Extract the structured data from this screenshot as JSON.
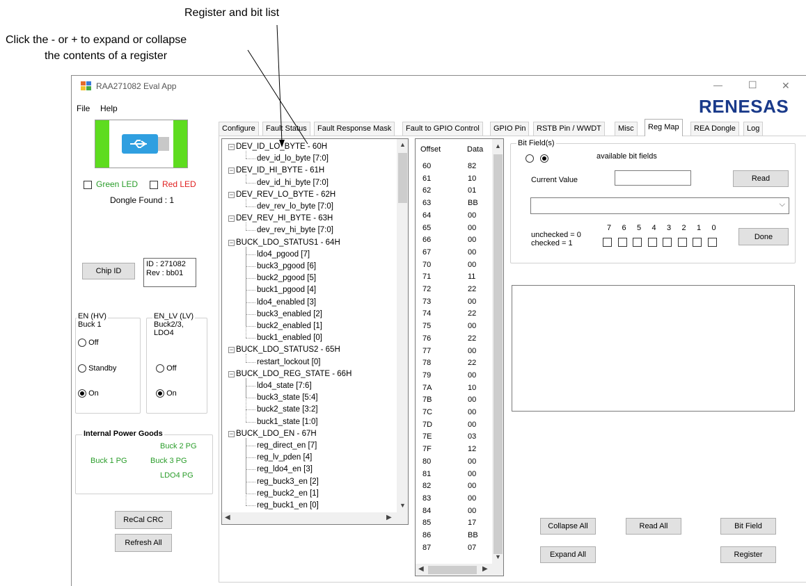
{
  "annotations": {
    "register_list": "Register and bit list",
    "expand_hint_line1": "Click the - or + to expand or collapse",
    "expand_hint_line2": "the contents of a register"
  },
  "window": {
    "title": "RAA271082 Eval App",
    "menu": [
      "File",
      "Help"
    ],
    "brand": "RENESAS",
    "minimize": "—",
    "maximize": "☐",
    "close": "✕"
  },
  "left": {
    "green_led": "Green LED",
    "red_led": "Red LED",
    "dongle": "Dongle Found : 1",
    "chip_id_button": "Chip ID",
    "chip_info_line1": "ID : 271082",
    "chip_info_line2": "Rev : bb01",
    "en_hv": {
      "title_line1": "EN (HV)",
      "title_line2": "Buck 1",
      "options": [
        "Off",
        "Standby",
        "On"
      ],
      "selected": "On"
    },
    "en_lv": {
      "title_line1": "EN_LV (LV)",
      "title_line2": "Buck2/3,",
      "title_line3": "LDO4",
      "options": [
        "Off",
        "On"
      ],
      "selected": "On"
    },
    "power_goods": {
      "title": "Internal Power Goods",
      "buck2": "Buck 2 PG",
      "buck1": "Buck 1 PG",
      "buck3": "Buck 3 PG",
      "ldo4": "LDO4 PG",
      "color": "#2a9d2a"
    },
    "recal_button": "ReCal CRC",
    "refresh_button": "Refresh All"
  },
  "tabs": [
    "Configure",
    "Fault Status",
    "Fault Response Mask",
    "Fault to GPIO Control",
    "GPIO Pin",
    "RSTB Pin / WWDT",
    "Misc",
    "Reg Map",
    "REA Dongle",
    "Log"
  ],
  "active_tab": "Reg Map",
  "tree": [
    {
      "label": "DEV_ID_LO_BYTE - 60H",
      "level": 0
    },
    {
      "label": "dev_id_lo_byte [7:0]",
      "level": 1
    },
    {
      "label": "DEV_ID_HI_BYTE - 61H",
      "level": 0
    },
    {
      "label": "dev_id_hi_byte [7:0]",
      "level": 1
    },
    {
      "label": "DEV_REV_LO_BYTE - 62H",
      "level": 0
    },
    {
      "label": "dev_rev_lo_byte [7:0]",
      "level": 1
    },
    {
      "label": "DEV_REV_HI_BYTE - 63H",
      "level": 0
    },
    {
      "label": "dev_rev_hi_byte [7:0]",
      "level": 1
    },
    {
      "label": "BUCK_LDO_STATUS1 - 64H",
      "level": 0
    },
    {
      "label": "ldo4_pgood [7]",
      "level": 1
    },
    {
      "label": "buck3_pgood [6]",
      "level": 1
    },
    {
      "label": "buck2_pgood [5]",
      "level": 1
    },
    {
      "label": "buck1_pgood [4]",
      "level": 1
    },
    {
      "label": "ldo4_enabled [3]",
      "level": 1
    },
    {
      "label": "buck3_enabled [2]",
      "level": 1
    },
    {
      "label": "buck2_enabled [1]",
      "level": 1
    },
    {
      "label": "buck1_enabled [0]",
      "level": 1
    },
    {
      "label": "BUCK_LDO_STATUS2 - 65H",
      "level": 0
    },
    {
      "label": "restart_lockout [0]",
      "level": 1
    },
    {
      "label": "BUCK_LDO_REG_STATE - 66H",
      "level": 0
    },
    {
      "label": "ldo4_state [7:6]",
      "level": 1
    },
    {
      "label": "buck3_state [5:4]",
      "level": 1
    },
    {
      "label": "buck2_state [3:2]",
      "level": 1
    },
    {
      "label": "buck1_state [1:0]",
      "level": 1
    },
    {
      "label": "BUCK_LDO_EN - 67H",
      "level": 0
    },
    {
      "label": "reg_direct_en [7]",
      "level": 1
    },
    {
      "label": "reg_lv_pden [4]",
      "level": 1
    },
    {
      "label": "reg_ldo4_en [3]",
      "level": 1
    },
    {
      "label": "reg_buck3_en [2]",
      "level": 1
    },
    {
      "label": "reg_buck2_en [1]",
      "level": 1
    },
    {
      "label": "reg_buck1_en [0]",
      "level": 1
    }
  ],
  "table": {
    "headers": [
      "Offset",
      "Data"
    ],
    "rows": [
      [
        "60",
        "82"
      ],
      [
        "61",
        "10"
      ],
      [
        "62",
        "01"
      ],
      [
        "63",
        "BB"
      ],
      [
        "64",
        "00"
      ],
      [
        "65",
        "00"
      ],
      [
        "66",
        "00"
      ],
      [
        "67",
        "00"
      ],
      [
        "70",
        "00"
      ],
      [
        "71",
        "11"
      ],
      [
        "72",
        "22"
      ],
      [
        "73",
        "00"
      ],
      [
        "74",
        "22"
      ],
      [
        "75",
        "00"
      ],
      [
        "76",
        "22"
      ],
      [
        "77",
        "00"
      ],
      [
        "78",
        "22"
      ],
      [
        "79",
        "00"
      ],
      [
        "7A",
        "10"
      ],
      [
        "7B",
        "00"
      ],
      [
        "7C",
        "00"
      ],
      [
        "7D",
        "00"
      ],
      [
        "7E",
        "03"
      ],
      [
        "7F",
        "12"
      ],
      [
        "80",
        "00"
      ],
      [
        "81",
        "00"
      ],
      [
        "82",
        "00"
      ],
      [
        "83",
        "00"
      ],
      [
        "84",
        "00"
      ],
      [
        "85",
        "17"
      ],
      [
        "86",
        "BB"
      ],
      [
        "87",
        "07"
      ]
    ]
  },
  "bitfield": {
    "title": "Bit Field(s)",
    "available": "available bit fields",
    "current_value_label": "Current Value",
    "current_value": "",
    "read_button": "Read",
    "select_value": "",
    "unchecked": "unchecked = 0",
    "checked": "checked = 1",
    "bits": [
      "7",
      "6",
      "5",
      "4",
      "3",
      "2",
      "1",
      "0"
    ],
    "done_button": "Done"
  },
  "buttons": {
    "collapse_all": "Collapse All",
    "read_all": "Read All",
    "bit_field": "Bit Field",
    "expand_all": "Expand All",
    "register": "Register"
  }
}
